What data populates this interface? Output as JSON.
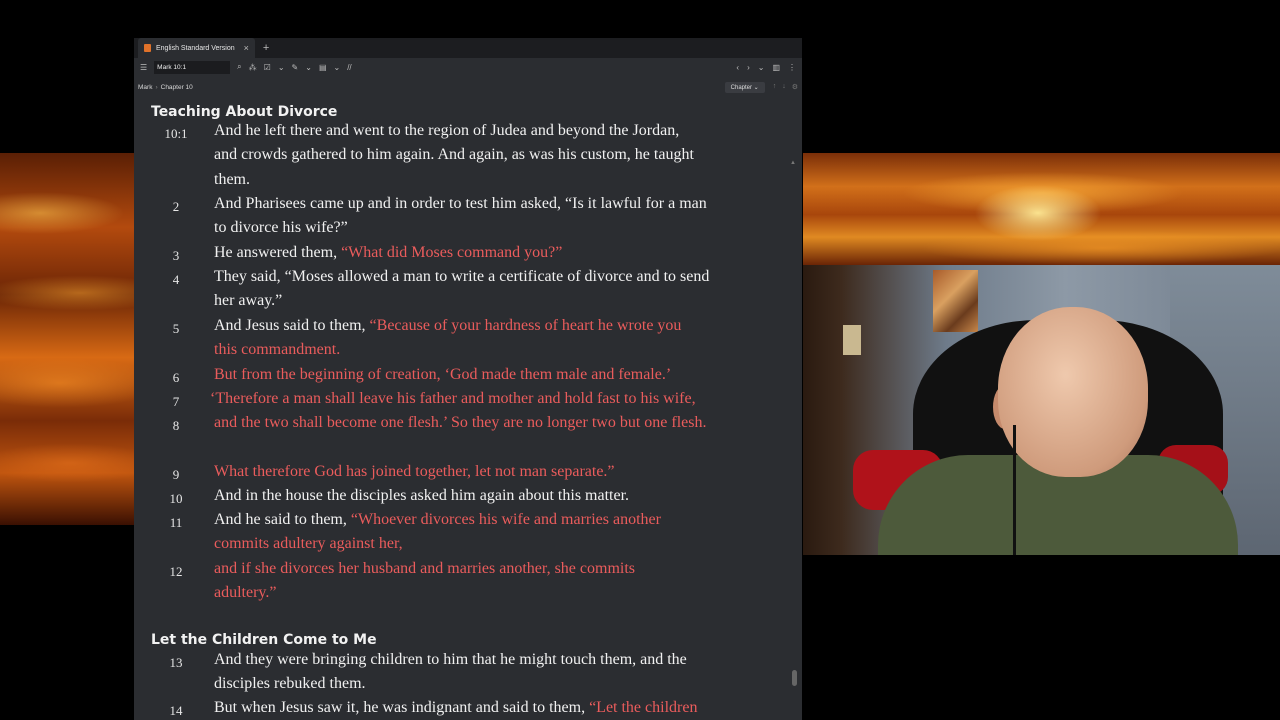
{
  "app": {
    "tab_title": "English Standard Version",
    "tab_close": "×",
    "tab_add": "+",
    "reference_input": "Mark 10:1",
    "book": "Mark",
    "chapter": "Chapter 10",
    "chapter_dropdown": "Chapter ⌄"
  },
  "sections": [
    {
      "heading": "Teaching About Divorce"
    },
    {
      "heading": "Let the Children Come to Me"
    }
  ],
  "verses": [
    {
      "num": "10:1",
      "lines": [
        [
          {
            "t": " And he left there and went to the region of Judea and beyond the Jordan,",
            "red": false
          }
        ],
        [
          {
            "t": "and crowds gathered to him again. And again, as was his custom, he taught",
            "red": false
          }
        ],
        [
          {
            "t": "them.",
            "red": false
          }
        ]
      ]
    },
    {
      "num": "2",
      "lines": [
        [
          {
            "t": " And Pharisees came up and in order to test him asked, “Is it lawful for a man",
            "red": false
          }
        ],
        [
          {
            "t": "to divorce his wife?”",
            "red": false
          }
        ]
      ]
    },
    {
      "num": "3",
      "lines": [
        [
          {
            "t": "He answered them, ",
            "red": false
          },
          {
            "t": "“What did Moses command you?”",
            "red": true
          }
        ]
      ]
    },
    {
      "num": "4",
      "lines": [
        [
          {
            "t": "They said, “Moses allowed a man to write a certificate of divorce and to send",
            "red": false
          }
        ],
        [
          {
            "t": "her away.”",
            "red": false
          }
        ]
      ]
    },
    {
      "num": "5",
      "lines": [
        [
          {
            "t": " And Jesus said to them, ",
            "red": false
          },
          {
            "t": "“Because of your hardness of heart he wrote you",
            "red": true
          }
        ],
        [
          {
            "t": "this commandment.",
            "red": true
          }
        ]
      ]
    },
    {
      "num": "6",
      "lines": [
        [
          {
            "t": "But from the beginning of creation, ‘God made them male and female.’",
            "red": true
          }
        ]
      ]
    },
    {
      "num": "7",
      "lines": [
        [
          {
            "t": "‘Therefore a man shall leave his father and mother and hold fast to his wife,",
            "red": true
          }
        ]
      ]
    },
    {
      "num": "8",
      "lines": [
        [
          {
            "t": " and the two shall become one flesh.’ So they are no longer two but one flesh.",
            "red": true
          }
        ]
      ]
    },
    {
      "num": "9",
      "lines": [
        [
          {
            "t": "What therefore God has joined together, let not man separate.”",
            "red": true
          }
        ]
      ]
    },
    {
      "num": "10",
      "lines": [
        [
          {
            "t": "And in the house the disciples asked him again about this matter.",
            "red": false
          }
        ]
      ]
    },
    {
      "num": "11",
      "lines": [
        [
          {
            "t": " And he said to them, ",
            "red": false
          },
          {
            "t": "“Whoever divorces his wife and marries another",
            "red": true
          }
        ],
        [
          {
            "t": "commits adultery against her,",
            "red": true
          }
        ]
      ]
    },
    {
      "num": "12",
      "lines": [
        [
          {
            "t": " and if she divorces her husband and marries another, she commits",
            "red": true
          }
        ],
        [
          {
            "t": "adultery.”",
            "red": true
          }
        ]
      ]
    },
    {
      "num": "13",
      "lines": [
        [
          {
            "t": " And they were bringing children to him that he might touch them, and the",
            "red": false
          }
        ],
        [
          {
            "t": "disciples rebuked them.",
            "red": false
          }
        ]
      ]
    },
    {
      "num": "14",
      "lines": [
        [
          {
            "t": " But when Jesus saw it, he was indignant and said to them, ",
            "red": false
          },
          {
            "t": "“Let the children",
            "red": true
          }
        ]
      ]
    }
  ],
  "colors": {
    "red_letter": "#ea5c5c",
    "app_background": "#2b2d31",
    "tab_icon": "#e0722a"
  }
}
